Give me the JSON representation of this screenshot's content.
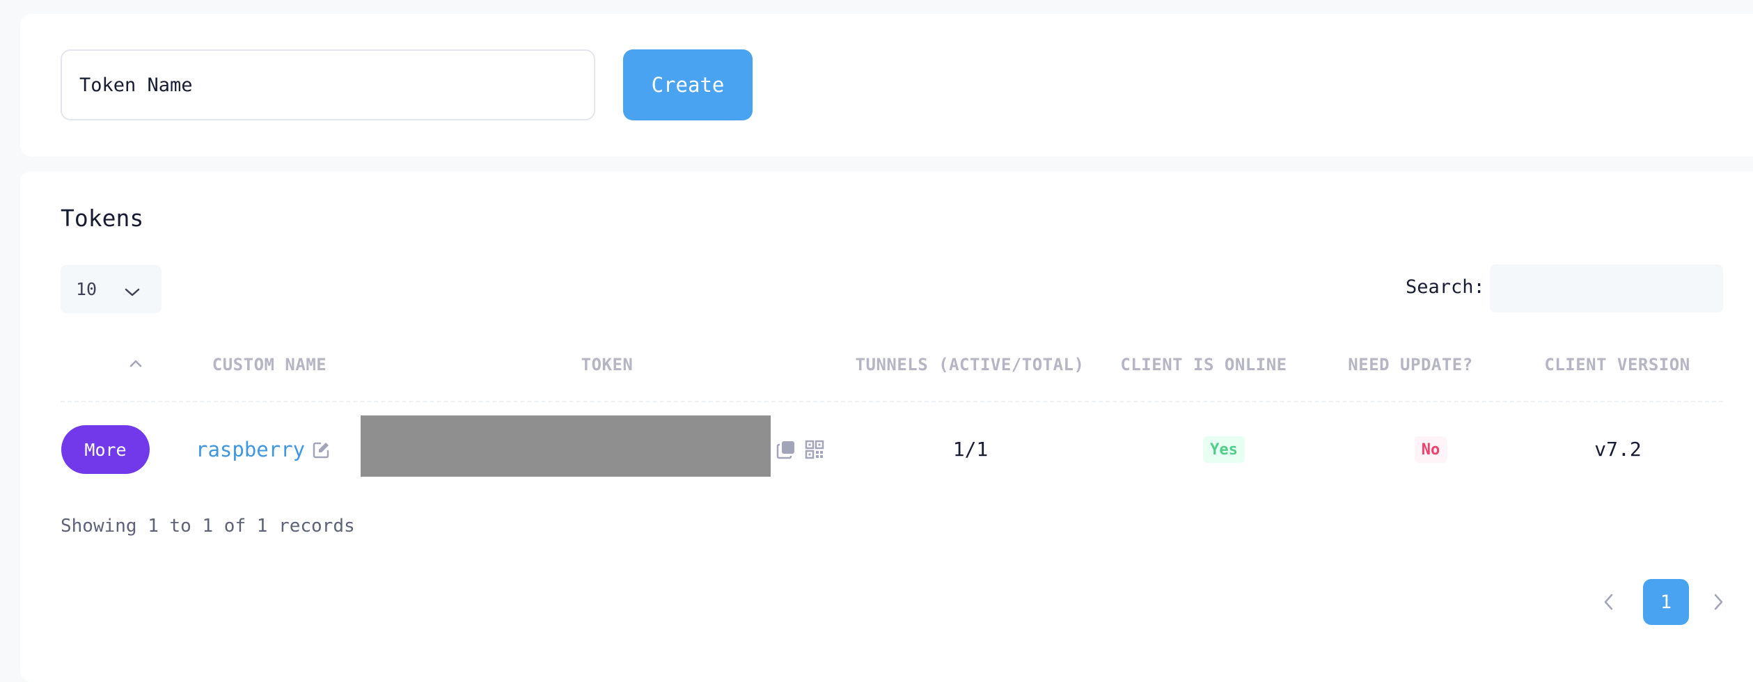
{
  "create_form": {
    "token_name_placeholder": "Token Name",
    "create_label": "Create"
  },
  "tokens_panel": {
    "title": "Tokens",
    "page_length": "10",
    "search_label": "Search:",
    "search_value": "",
    "columns": [
      "CUSTOM NAME",
      "TOKEN",
      "TUNNELS (ACTIVE/TOTAL)",
      "CLIENT IS ONLINE",
      "NEED UPDATE?",
      "CLIENT VERSION"
    ],
    "rows": [
      {
        "action_label": "More",
        "custom_name": "raspberry",
        "tunnels": "1/1",
        "client_online": "Yes",
        "need_update": "No",
        "client_version": "v7.2"
      }
    ],
    "records_info": "Showing 1 to 1 of 1 records",
    "pagination": {
      "current_page": "1"
    }
  },
  "icons": [
    "chevron-down-icon",
    "sort-up-icon",
    "edit-icon",
    "copy-icon",
    "qr-code-icon",
    "chevron-left-icon",
    "chevron-right-icon"
  ],
  "colors": {
    "primary": "#4aa3f0",
    "more_button": "#7239ea",
    "link": "#3e97e0",
    "success": "#50cd89",
    "danger": "#f1416c",
    "header_text": "#b5b5c3"
  }
}
